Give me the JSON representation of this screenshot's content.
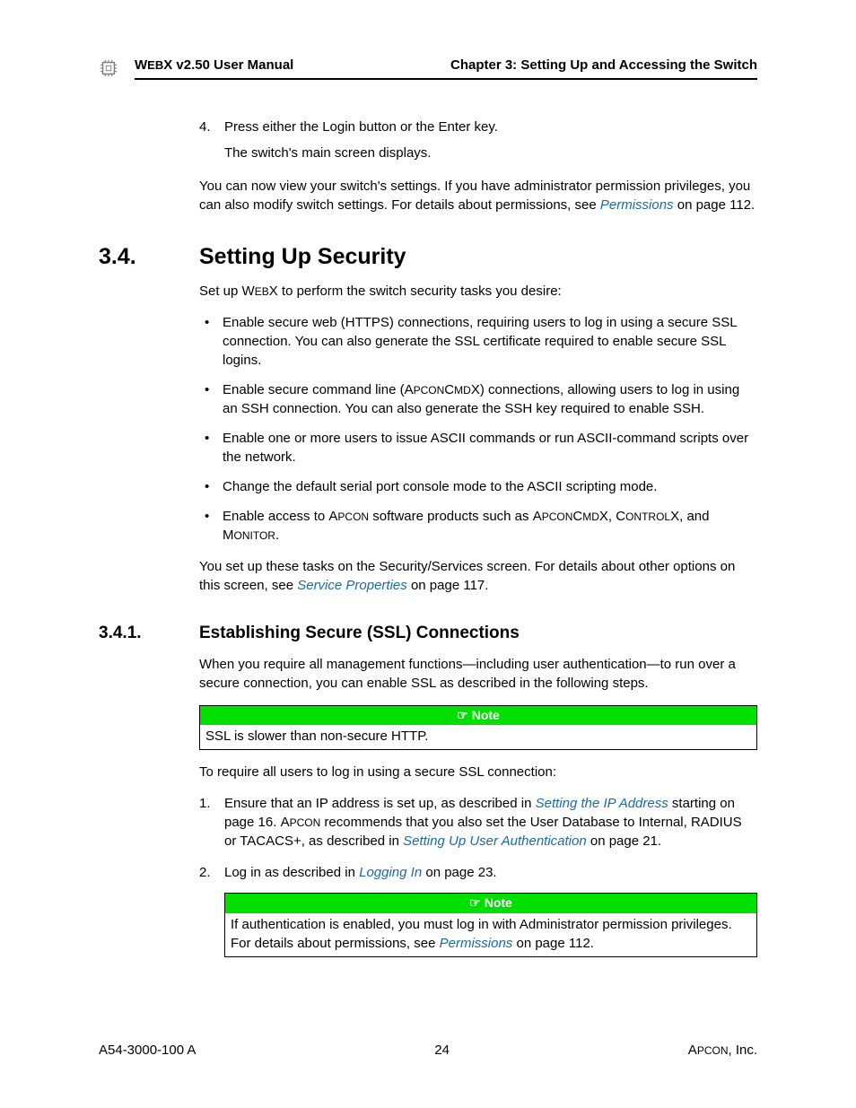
{
  "header": {
    "product": "WebX",
    "version": "v2.50",
    "doc_type": "User Manual",
    "chapter": "Chapter 3: Setting Up and Accessing the Switch"
  },
  "step4": {
    "num": "4.",
    "text": "Press either the Login button or the Enter key.",
    "after": "The switch's main screen displays."
  },
  "para_viewsettings_a": "You can now view your switch's settings. If you have administrator permission privileges, you can also modify switch settings. For details about permissions, see ",
  "link_permissions": "Permissions",
  "para_viewsettings_b": " on page 112.",
  "sec34": {
    "num": "3.4.",
    "title": "Setting Up Security",
    "intro_a": "Set up ",
    "intro_b": "WebX",
    "intro_c": " to perform the switch security tasks you desire:"
  },
  "bullets34": {
    "b1": "Enable secure web (HTTPS) connections, requiring users to log in using a secure SSL connection. You can also generate the SSL certificate required to enable secure SSL logins.",
    "b2_a": "Enable secure command line (",
    "b2_b": "ApconCmdX",
    "b2_c": ") connections, allowing users to log in using an SSH connection. You can also generate the SSH key required to enable SSH.",
    "b3": "Enable one or more users to issue ASCII commands or run ASCII-command scripts over the network.",
    "b4": "Change the default serial port console mode to the ASCII scripting mode.",
    "b5_a": "Enable access to ",
    "b5_b": "Apcon",
    "b5_c": " software products such as ",
    "b5_d": "ApconCmdX",
    "b5_e": ", ",
    "b5_f": "ControlX",
    "b5_g": ", and ",
    "b5_h": "Monitor",
    "b5_i": "."
  },
  "para_setuptasks_a": "You set up these tasks on the Security/Services screen. For details about other options on this screen, see ",
  "link_serviceprops": "Service Properties",
  "para_setuptasks_b": " on page 117.",
  "sec341": {
    "num": "3.4.1.",
    "title": "Establishing Secure (SSL) Connections",
    "intro": "When you require all management functions—including user authentication—to run over a secure connection, you can enable SSL as described in the following steps."
  },
  "note1": {
    "label": "Note",
    "body": "SSL is slower than non-secure HTTP."
  },
  "para_require": "To require all users to log in using a secure SSL connection:",
  "ol": {
    "i1_a": "Ensure that an IP address is set up, as described in ",
    "i1_link1": "Setting the IP Address",
    "i1_b": " starting on page 16. ",
    "i1_c": "Apcon",
    "i1_d": " recommends that you also set the User Database to Internal, RADIUS or TACACS+, as described in ",
    "i1_link2": "Setting Up User Authentication",
    "i1_e": " on page 21.",
    "i2_a": "Log in as described in ",
    "i2_link": "Logging In",
    "i2_b": " on page 23."
  },
  "note2": {
    "label": "Note",
    "body_a": "If authentication is enabled, you must log in with Administrator permission privileges. For details about permissions, see ",
    "body_link": "Permissions",
    "body_b": " on page 112."
  },
  "footer": {
    "left": "A54-3000-100 A",
    "center": "24",
    "right_a": "Apcon",
    "right_b": ", Inc."
  }
}
